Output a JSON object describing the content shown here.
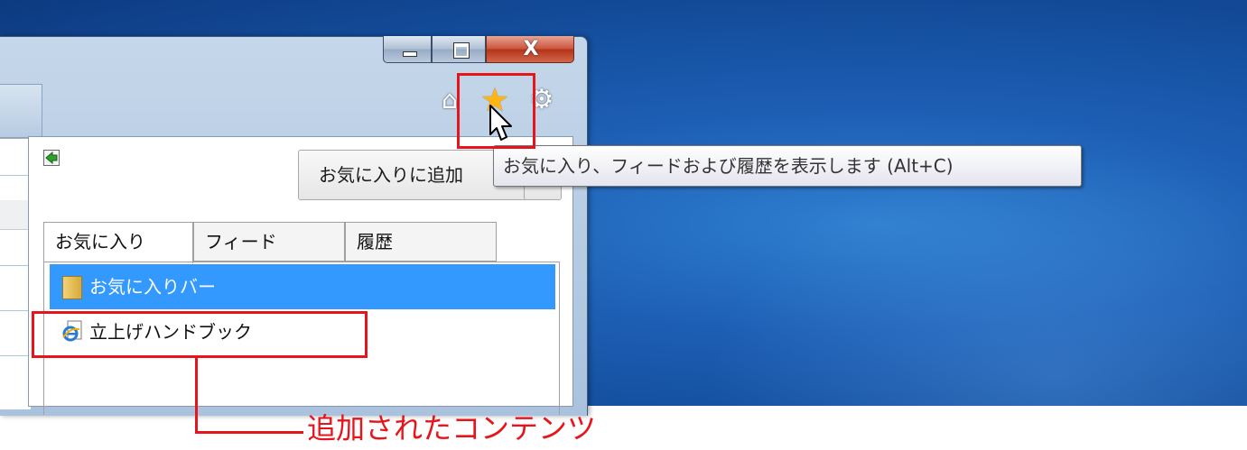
{
  "window": {
    "close_glyph": "X"
  },
  "toolbar": {
    "home_icon": "⌂",
    "star_icon": "★",
    "gear_icon": "⚙"
  },
  "favorites_center": {
    "add_button_label": "お気に入りに追加",
    "tabs": [
      {
        "label": "お気に入り"
      },
      {
        "label": "フィード"
      },
      {
        "label": "履歴"
      }
    ],
    "items": [
      {
        "label": "お気に入りバー",
        "icon": "folder-icon",
        "selected": true
      },
      {
        "label": "立上げハンドブック",
        "icon": "ie-page-icon",
        "selected": false
      }
    ]
  },
  "tooltip": {
    "text": "お気に入り、フィードおよび履歴を表示します (Alt+C)"
  },
  "annotation": {
    "text": "追加されたコンテンツ",
    "color": "#e8141b"
  }
}
